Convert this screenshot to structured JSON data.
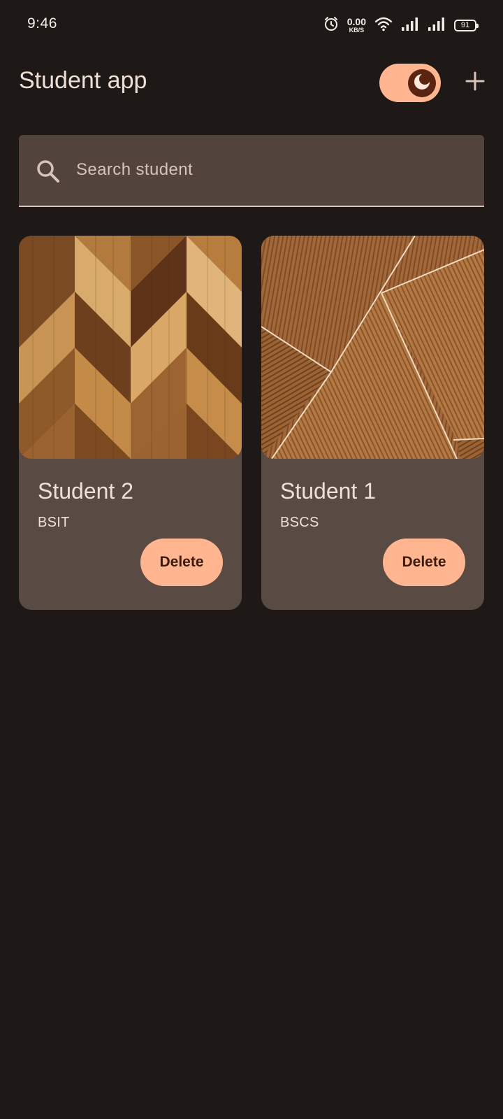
{
  "status_bar": {
    "time": "9:46",
    "net_speed_value": "0.00",
    "net_speed_unit": "KB/S",
    "battery": "91",
    "icons": [
      "alarm-icon",
      "wifi-icon",
      "signal-icon",
      "signal-icon",
      "battery-icon"
    ]
  },
  "app_bar": {
    "title": "Student app",
    "theme_toggle_icon": "moon-icon",
    "add_icon": "plus-icon"
  },
  "search": {
    "placeholder": "Search student",
    "value": ""
  },
  "students": [
    {
      "name": "Student 2",
      "program": "BSIT",
      "delete_label": "Delete",
      "image": "wood-chevron-pattern"
    },
    {
      "name": "Student 1",
      "program": "BSCS",
      "delete_label": "Delete",
      "image": "wood-triangle-pattern"
    }
  ],
  "colors": {
    "background": "#1e1916",
    "surface": "#594a43",
    "accent": "#ffb690",
    "on_surface": "#efe0d6"
  }
}
